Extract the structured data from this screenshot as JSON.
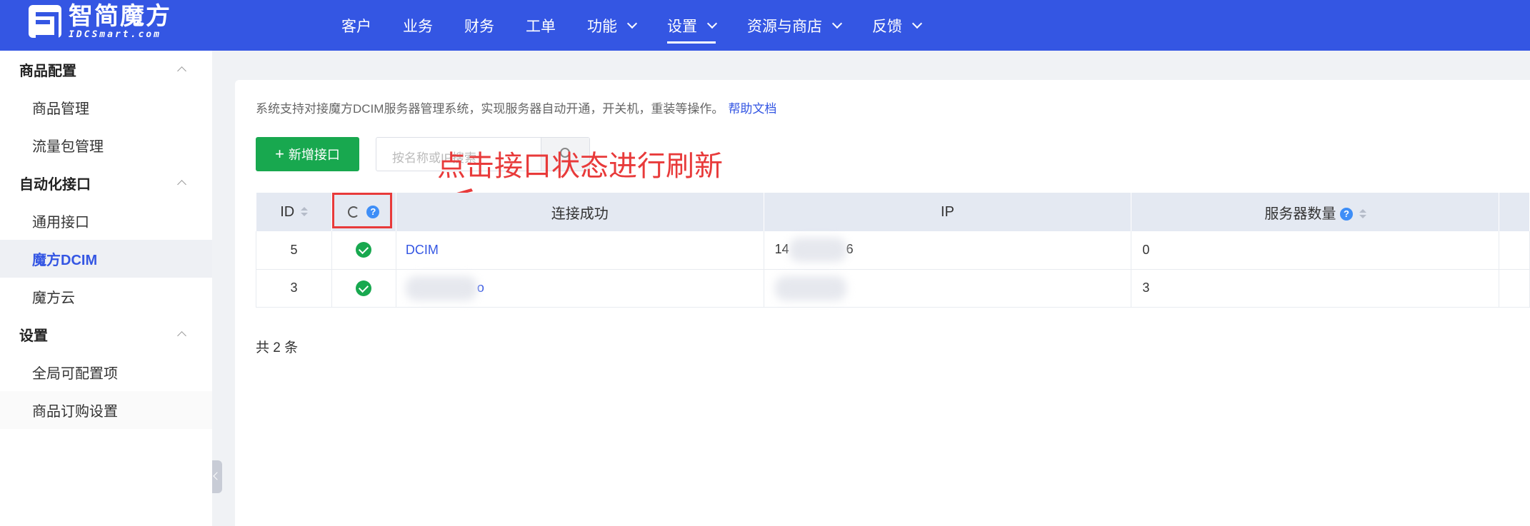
{
  "brand": {
    "name_cn": "智简魔方",
    "name_en": "IDCSmart.com"
  },
  "nav": [
    {
      "label": "客户",
      "dropdown": false,
      "active": false
    },
    {
      "label": "业务",
      "dropdown": false,
      "active": false
    },
    {
      "label": "财务",
      "dropdown": false,
      "active": false
    },
    {
      "label": "工单",
      "dropdown": false,
      "active": false
    },
    {
      "label": "功能",
      "dropdown": true,
      "active": false
    },
    {
      "label": "设置",
      "dropdown": true,
      "active": true
    },
    {
      "label": "资源与商店",
      "dropdown": true,
      "active": false
    },
    {
      "label": "反馈",
      "dropdown": true,
      "active": false
    }
  ],
  "sidebar": {
    "groups": [
      {
        "title": "商品配置",
        "items": [
          "商品管理",
          "流量包管理"
        ]
      },
      {
        "title": "自动化接口",
        "items": [
          "通用接口",
          "魔方DCIM",
          "魔方云"
        ]
      },
      {
        "title": "设置",
        "items": [
          "全局可配置项",
          "商品订购设置"
        ]
      }
    ],
    "active_item": "魔方DCIM"
  },
  "main": {
    "description": "系统支持对接魔方DCIM服务器管理系统，实现服务器自动开通，开关机，重装等操作。",
    "help_link": "帮助文档",
    "add_button": "新增接口",
    "search_placeholder": "按名称或IP搜索",
    "annotation": "点击接口状态进行刷新",
    "table": {
      "headers": {
        "id": "ID",
        "status": "",
        "name": "连接成功",
        "ip": "IP",
        "count": "服务器数量"
      },
      "rows": [
        {
          "id": "5",
          "status": "success",
          "name": "DCIM",
          "ip": "14",
          "ip_tail": "6",
          "count": "0"
        },
        {
          "id": "3",
          "status": "success",
          "name": "",
          "name_tail": "o",
          "ip": "",
          "count": "3"
        }
      ]
    },
    "total": "共 2 条"
  },
  "colors": {
    "topbar": "#3456e3",
    "primary": "#3456e3",
    "success": "#18a84f",
    "annotation": "#e83a3a"
  }
}
